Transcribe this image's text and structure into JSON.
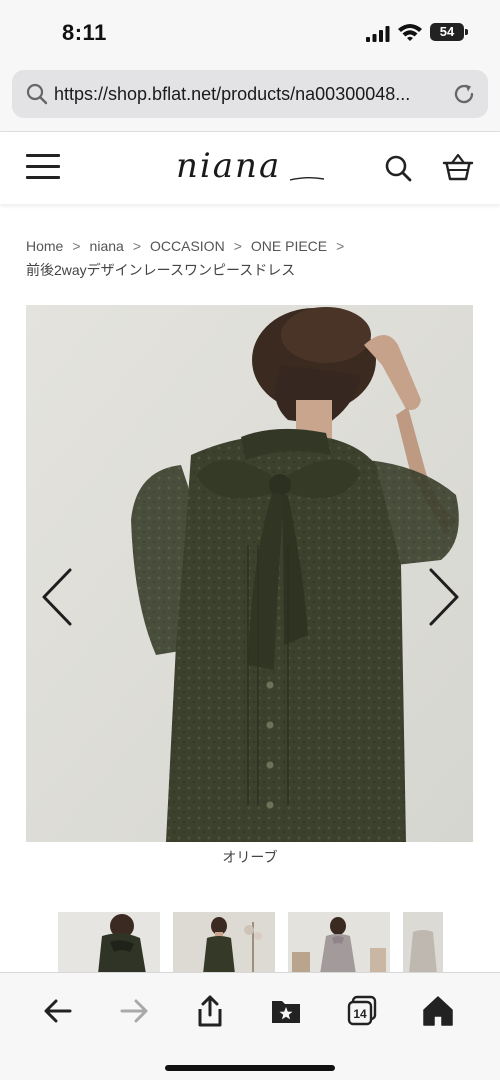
{
  "status_bar": {
    "time": "8:11",
    "battery": "54"
  },
  "browser": {
    "url": "https://shop.bflat.net/products/na00300048...",
    "icons": [
      "search-icon",
      "reload-icon"
    ]
  },
  "site": {
    "logo": "niana",
    "icons": [
      "menu-icon",
      "search-icon",
      "cart-icon"
    ]
  },
  "breadcrumb": {
    "items": [
      "Home",
      "niana",
      "OCCASION",
      "ONE PIECE"
    ],
    "separator": ">",
    "current": "前後2wayデザインレースワンピースドレス"
  },
  "product": {
    "color_caption": "オリーブ",
    "icons": [
      "chevron-left-icon",
      "chevron-right-icon"
    ]
  },
  "toolbar": {
    "tabs_count": "14",
    "icons": [
      "back-icon",
      "forward-icon",
      "share-icon",
      "bookmarks-icon",
      "tabs-icon",
      "home-icon"
    ]
  },
  "colors": {
    "dress": "#3a3f2c",
    "background_photo": "#dddcd6",
    "header_bg": "#f7f7f7"
  }
}
